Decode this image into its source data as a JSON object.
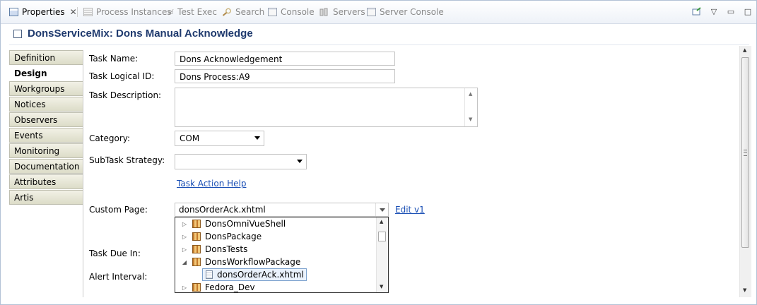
{
  "tabs": [
    {
      "label": "Properties",
      "active": true,
      "icon": "properties-icon"
    },
    {
      "label": "Process Instances",
      "active": false,
      "icon": "process-instances-icon"
    },
    {
      "label": "Test Exec",
      "active": false,
      "icon": "test-exec-icon"
    },
    {
      "label": "Search",
      "active": false,
      "icon": "search-icon"
    },
    {
      "label": "Console",
      "active": false,
      "icon": "console-icon"
    },
    {
      "label": "Servers",
      "active": false,
      "icon": "servers-icon"
    },
    {
      "label": "Server Console",
      "active": false,
      "icon": "server-console-icon"
    }
  ],
  "window_controls": {
    "minimize": "▭",
    "maximize": "□",
    "menu": "▽"
  },
  "title": "DonsServiceMix: Dons Manual Acknowledge",
  "nav": {
    "items": [
      "Definition",
      "Design",
      "Workgroups",
      "Notices",
      "Observers",
      "Events",
      "Monitoring",
      "Documentation",
      "Attributes",
      "Artis"
    ],
    "active": "Design"
  },
  "form": {
    "task_name": {
      "label": "Task Name:",
      "value": "Dons Acknowledgement"
    },
    "task_logical_id": {
      "label": "Task Logical ID:",
      "value": "Dons Process:A9"
    },
    "task_description": {
      "label": "Task Description:",
      "value": ""
    },
    "category": {
      "label": "Category:",
      "value": "COM"
    },
    "subtask_strategy": {
      "label": "SubTask Strategy:",
      "value": ""
    },
    "task_action_help": "Task Action Help",
    "custom_page": {
      "label": "Custom Page:",
      "value": "donsOrderAck.xhtml",
      "edit_link": "Edit v1"
    },
    "task_due_in": {
      "label": "Task Due In:"
    },
    "alert_interval": {
      "label": "Alert Interval:"
    }
  },
  "tree": [
    {
      "label": "DonsOmniVueShell",
      "type": "package",
      "expanded": false
    },
    {
      "label": "DonsPackage",
      "type": "package",
      "expanded": false
    },
    {
      "label": "DonsTests",
      "type": "package",
      "expanded": false
    },
    {
      "label": "DonsWorkflowPackage",
      "type": "package",
      "expanded": true
    },
    {
      "label": "donsOrderAck.xhtml",
      "type": "file",
      "selected": true
    },
    {
      "label": "Fedora_Dev",
      "type": "package",
      "expanded": false
    }
  ]
}
